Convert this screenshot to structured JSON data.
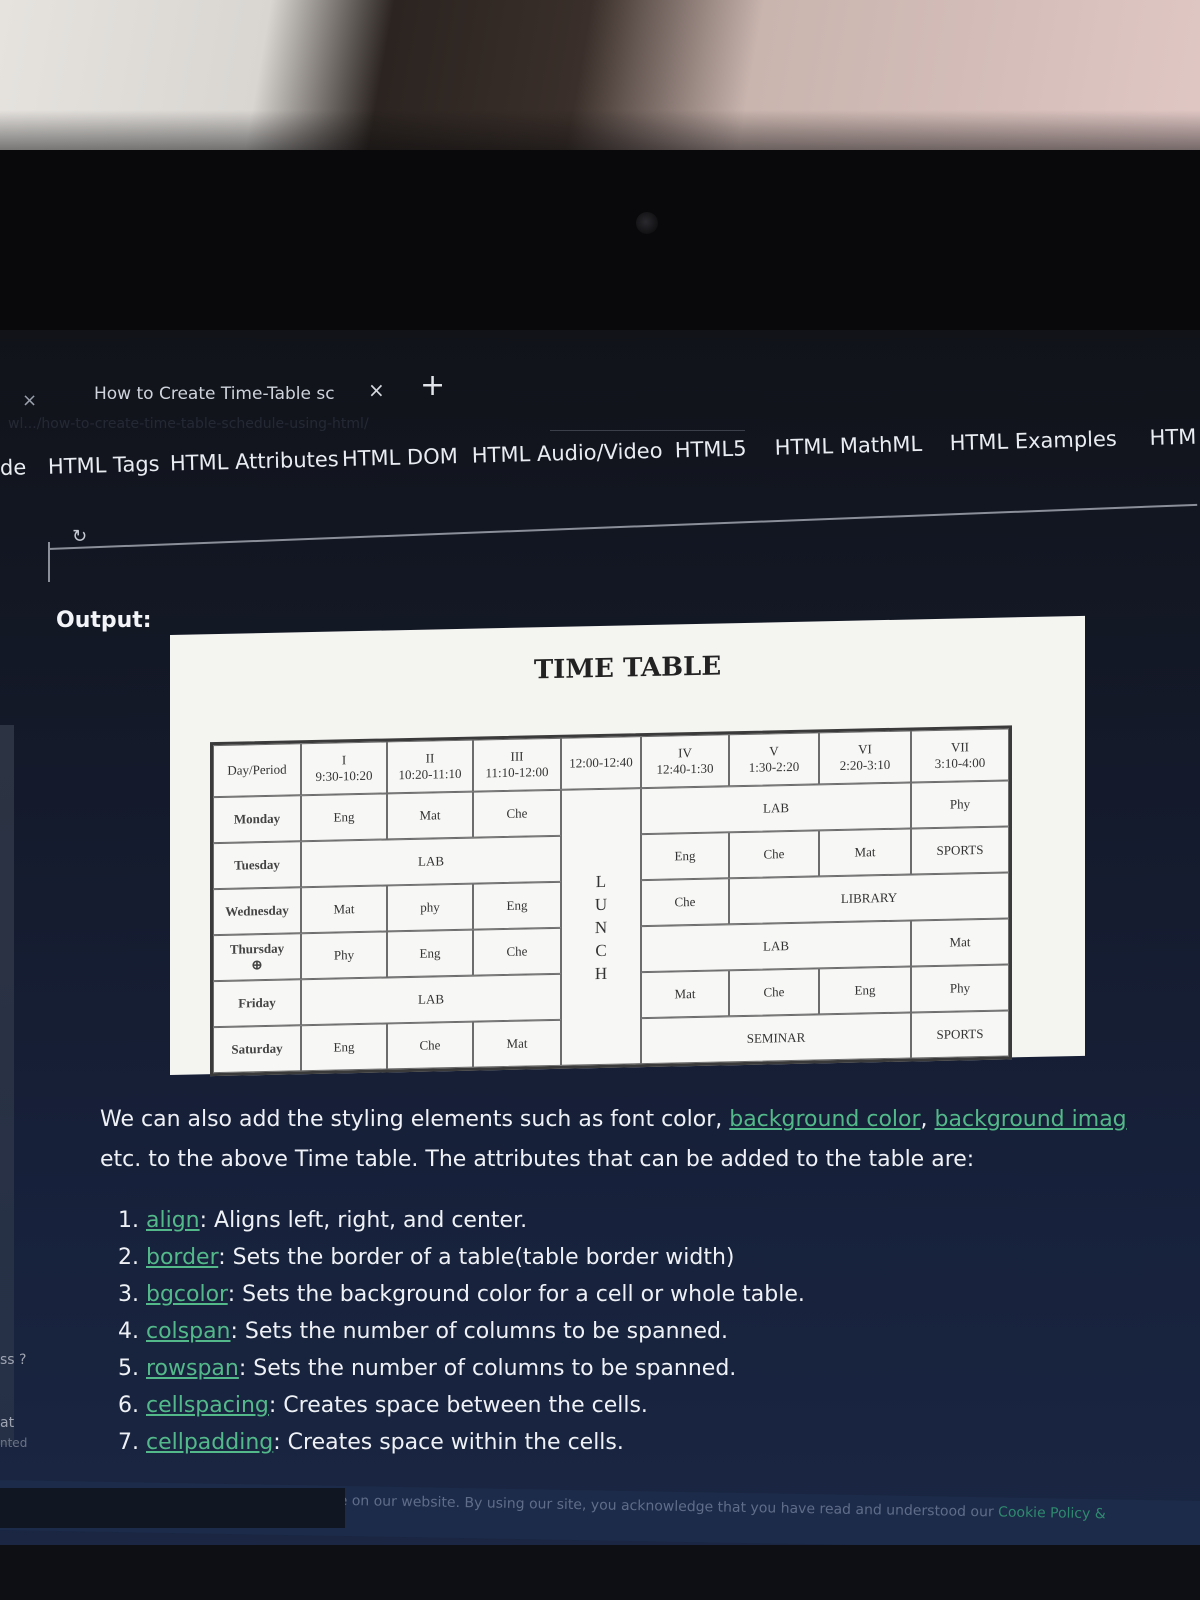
{
  "browser": {
    "tab_title": "How to Create Time-Table sch",
    "close_left": "×",
    "tab_close": "×",
    "new_tab": "+",
    "url_faded": "wl.../how-to-create-time-table-schedule-using-html/"
  },
  "site_nav": {
    "items": [
      "de",
      "HTML Tags",
      "HTML Attributes",
      "HTML DOM",
      "HTML Audio/Video",
      "HTML5",
      "HTML MathML",
      "HTML Examples",
      "HTM"
    ]
  },
  "output_label": "Output:",
  "timetable": {
    "title": "TIME TABLE",
    "header": {
      "day_period": "Day/Period",
      "periods": [
        {
          "roman": "I",
          "time": "9:30-10:20"
        },
        {
          "roman": "II",
          "time": "10:20-11:10"
        },
        {
          "roman": "III",
          "time": "11:10-12:00"
        },
        {
          "roman": "",
          "time": "12:00-12:40"
        },
        {
          "roman": "IV",
          "time": "12:40-1:30"
        },
        {
          "roman": "V",
          "time": "1:30-2:20"
        },
        {
          "roman": "VI",
          "time": "2:20-3:10"
        },
        {
          "roman": "VII",
          "time": "3:10-4:00"
        }
      ]
    },
    "days": [
      "Monday",
      "Tuesday",
      "Wednesday",
      "Thursday",
      "Friday",
      "Saturday"
    ],
    "lunch_letters": [
      "L",
      "U",
      "N",
      "C",
      "H"
    ],
    "monday": {
      "p1": "Eng",
      "p2": "Mat",
      "p3": "Che",
      "p4_6": "LAB",
      "p7": "Phy"
    },
    "tuesday": {
      "p1_3": "LAB",
      "p4": "Eng",
      "p5": "Che",
      "p6": "Mat",
      "p7": "SPORTS"
    },
    "wednesday": {
      "p1": "Mat",
      "p2": "phy",
      "p3": "Eng",
      "p4": "Che",
      "p5_7": "LIBRARY"
    },
    "thursday": {
      "p1": "Phy",
      "p2": "Eng",
      "p3": "Che",
      "p4_6": "LAB",
      "p7": "Mat"
    },
    "friday": {
      "p1_3": "LAB",
      "p4": "Mat",
      "p5": "Che",
      "p6": "Eng",
      "p7": "Phy"
    },
    "saturday": {
      "p1": "Eng",
      "p2": "Che",
      "p3": "Mat",
      "p4_6": "SEMINAR",
      "p7": "SPORTS"
    }
  },
  "article": {
    "para_pre": "We can also add the styling elements such as font color, ",
    "link_bg_color": "background color",
    "comma": ", ",
    "link_bg_image": "background imag",
    "para_line2": "etc. to the above Time table. The attributes that can be added to the table are:",
    "attributes": [
      {
        "num": "1. ",
        "name": "align",
        "desc": ": Aligns left, right, and center."
      },
      {
        "num": "2. ",
        "name": "border",
        "desc": ": Sets the border of a table(table border width)"
      },
      {
        "num": "3. ",
        "name": "bgcolor",
        "desc": ": Sets the background color for a cell or whole table."
      },
      {
        "num": "4. ",
        "name": "colspan",
        "desc": ": Sets the number of columns to be spanned."
      },
      {
        "num": "5. ",
        "name": "rowspan",
        "desc": ": Sets the number of columns to be spanned."
      },
      {
        "num": "6. ",
        "name": "cellspacing",
        "desc": ": Creates space between the cells."
      },
      {
        "num": "7. ",
        "name": "cellpadding",
        "desc": ": Creates space within the cells."
      }
    ]
  },
  "sidebar_fragments": {
    "a": "ss ?",
    "b": "at",
    "c": "nted"
  },
  "cookie_banner": {
    "text": "o ensure you have the best browsing experience on our website. By using our site, you acknowledge that you have read and understood our ",
    "link": "Cookie Policy &"
  },
  "colors": {
    "link": "#53b98a",
    "screen_bg": "#17213b",
    "panel_bg": "#f4f4f1"
  }
}
